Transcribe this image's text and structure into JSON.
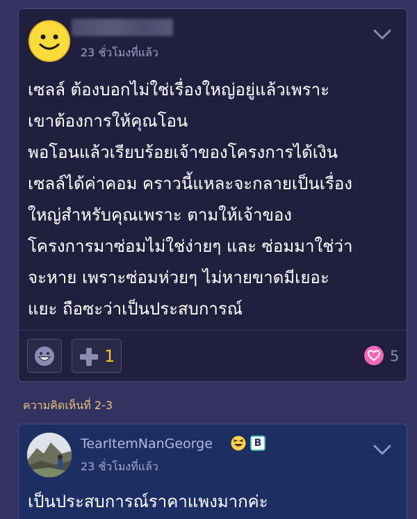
{
  "comment1": {
    "avatar_icon": "smiley-face-icon",
    "time_ago": "23 ชั่วโมงที่แล้ว",
    "lines": [
      "เซลล์ ต้องบอกไม่ใช่เรื่องใหญ่อยู่แล้วเพราะ",
      "เขาต้องการให้คุณโอน",
      "พอโอนแล้วเรียบร้อยเจ้าของโครงการได้เงิน",
      "เซลล์ได้ค่าคอม คราวนี้แหละจะกลายเป็นเรื่อง",
      "ใหญ่สำหรับคุณเพราะ ตามให้เจ้าของ",
      "โครงการมาซ่อมไม่ใช่ง่ายๆ และ ซ่อมมาใช่ว่า",
      "จะหาย เพราะซ่อมห่วยๆ ไม่หายขาดมีเยอะ",
      "แยะ ถือซะว่าเป็นประสบการณ์"
    ],
    "plus_count": "1",
    "heart_count": "5"
  },
  "section_label": "ความคิดเห็นที่ 2-3",
  "comment2": {
    "username": "TearItemNanGeorge",
    "badge_letter": "B",
    "time_ago": "23 ชั่วโมงที่แล้ว",
    "text": "เป็นประสบการณ์ราคาแพงมากค่ะ"
  },
  "colors": {
    "background": "#333261",
    "card1_bg": "#201f3d",
    "card2_bg": "#1d2e62",
    "accent_yellow": "#f6c525",
    "heart_pink": "#f268b7",
    "section_label": "#e8c77a"
  }
}
